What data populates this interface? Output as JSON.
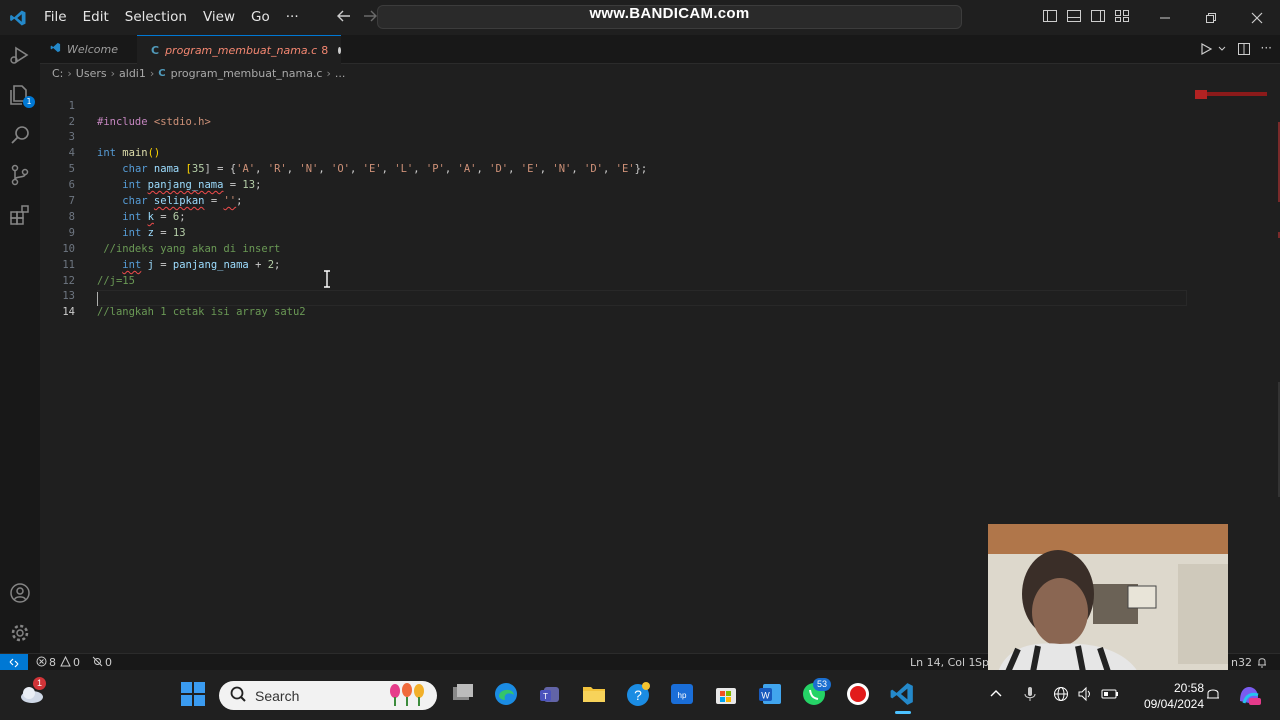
{
  "menu": {
    "file": "File",
    "edit": "Edit",
    "selection": "Selection",
    "view": "View",
    "go": "Go",
    "more": "···"
  },
  "watermark": "www.BANDICAM.com",
  "tabs": {
    "welcome": "Welcome",
    "active_file": "program_membuat_nama.c",
    "active_problems": "8"
  },
  "breadcrumb": {
    "drive": "C:",
    "users": "Users",
    "user": "aldi1",
    "file": "program_membuat_nama.c",
    "ellipsis": "..."
  },
  "code": {
    "l1_pp": "#include",
    "l1_inc": "<stdio.h>",
    "l3_type": "int",
    "l3_fn": "main",
    "l3_paren": "()",
    "l4_type": "char",
    "l4_var": "nama",
    "l4_size_open": "[",
    "l4_size": "35",
    "l4_rest": "] = {",
    "l4_chars": [
      "'A'",
      "'R'",
      "'N'",
      "'O'",
      "'E'",
      "'L'",
      "'P'",
      "'A'",
      "'D'",
      "'E'",
      "'N'",
      "'D'",
      "'E'"
    ],
    "l4_close": "};",
    "l5_type": "int",
    "l5_var": "panjang_nama",
    "l5_eq": " = ",
    "l5_num": "13",
    "l5_end": ";",
    "l6_type": "char",
    "l6_var": "selipkan",
    "l6_eq": " = ",
    "l6_str": "''",
    "l6_end": ";",
    "l7_type": "int",
    "l7_var": "k",
    "l7_eq": " = ",
    "l7_num": "6",
    "l7_end": ";",
    "l8_type": "int",
    "l8_var": "z",
    "l8_eq": " = ",
    "l8_num": "13",
    "l9_cmt": "//indeks yang akan di insert",
    "l10_type": "int",
    "l10_var": "j",
    "l10_eq": " = ",
    "l10_var2": "panjang_nama",
    "l10_plus": " + ",
    "l10_num": "2",
    "l10_end": ";",
    "l11_cmt": "//j=15",
    "l13_cmt": "//langkah 1 cetak isi array satu2"
  },
  "line_numbers": [
    "1",
    "2",
    "3",
    "4",
    "5",
    "6",
    "7",
    "8",
    "9",
    "10",
    "11",
    "12",
    "13",
    "14"
  ],
  "status": {
    "errors": "8",
    "warnings": "0",
    "ports": "0",
    "position": "Ln 14, Col 1",
    "spaces_partial": "Sp",
    "platform_partial": "n32"
  },
  "taskbar": {
    "search_label": "Search",
    "time": "20:58",
    "date": "09/04/2024",
    "notif_badge": "1",
    "whatsapp_badge": "53"
  },
  "colors": {
    "accent": "#0078d4",
    "error": "#f14c4c"
  }
}
